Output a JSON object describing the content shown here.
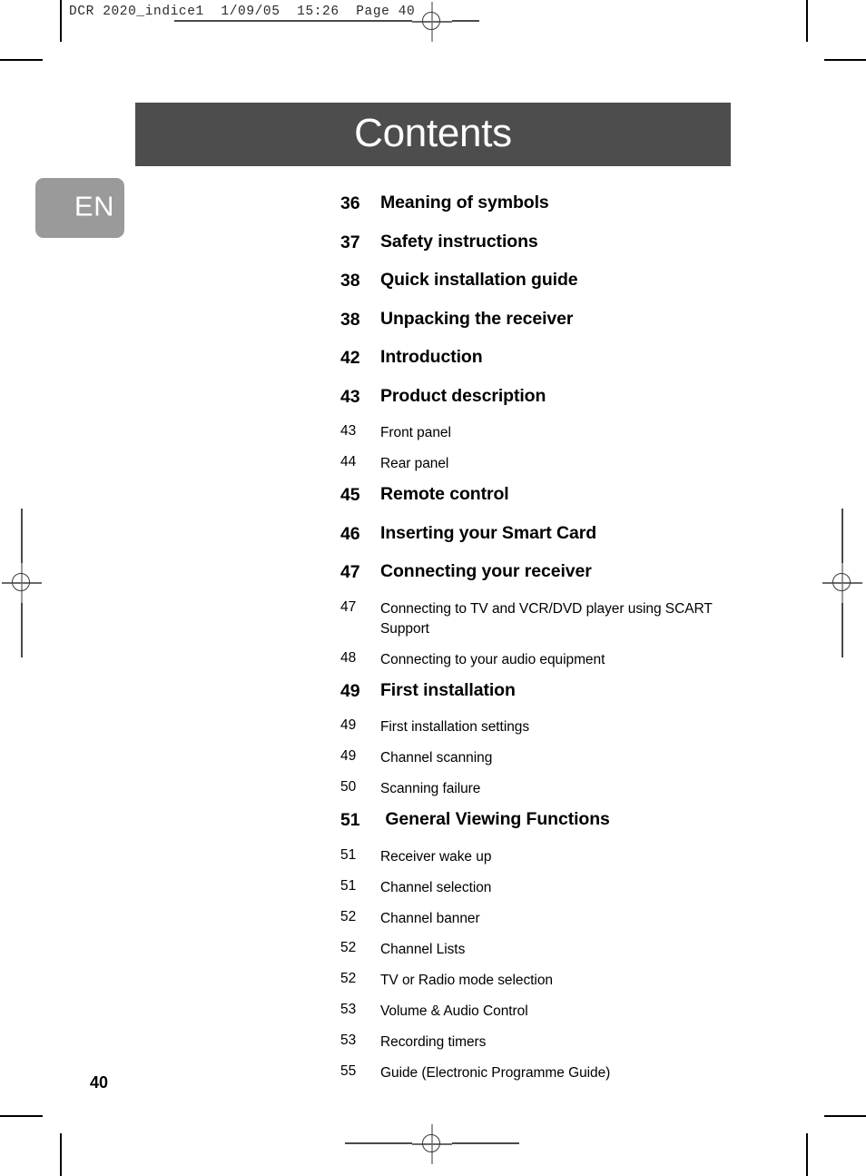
{
  "printer_header": "DCR 2020_indice1  1/09/05  15:26  Page 40",
  "title_bar": {
    "title": "Contents",
    "background_color": "#4d4d4d",
    "text_color": "#ffffff"
  },
  "language_tab": {
    "label": "EN",
    "background_color": "#9a9a9a",
    "text_color": "#ffffff"
  },
  "toc": {
    "entries": [
      {
        "page": "36",
        "label": "Meaning of symbols",
        "level": "major"
      },
      {
        "page": "37",
        "label": "Safety instructions",
        "level": "major"
      },
      {
        "page": "38",
        "label": "Quick installation guide",
        "level": "major"
      },
      {
        "page": "38",
        "label": "Unpacking the receiver",
        "level": "major"
      },
      {
        "page": "42",
        "label": "Introduction",
        "level": "major"
      },
      {
        "page": "43",
        "label": "Product description",
        "level": "major"
      },
      {
        "page": "43",
        "label": "Front panel",
        "level": "minor"
      },
      {
        "page": "44",
        "label": "Rear panel",
        "level": "minor"
      },
      {
        "page": "45",
        "label": "Remote control",
        "level": "major"
      },
      {
        "page": "46",
        "label": "Inserting your Smart Card",
        "level": "major"
      },
      {
        "page": "47",
        "label": "Connecting your receiver",
        "level": "major"
      },
      {
        "page": "47",
        "label": "Connecting to TV and VCR/DVD player using SCART Support",
        "level": "minor"
      },
      {
        "page": "48",
        "label": "Connecting to your audio equipment",
        "level": "minor"
      },
      {
        "page": "49",
        "label": "First installation",
        "level": "major"
      },
      {
        "page": "49",
        "label": "First installation settings",
        "level": "minor"
      },
      {
        "page": "49",
        "label": "Channel scanning",
        "level": "minor"
      },
      {
        "page": "50",
        "label": "Scanning failure",
        "level": "minor"
      },
      {
        "page": "51",
        "label": " General Viewing Functions",
        "level": "major"
      },
      {
        "page": "51",
        "label": "Receiver wake up",
        "level": "minor"
      },
      {
        "page": "51",
        "label": "Channel selection",
        "level": "minor"
      },
      {
        "page": "52",
        "label": "Channel banner",
        "level": "minor"
      },
      {
        "page": "52",
        "label": "Channel Lists",
        "level": "minor"
      },
      {
        "page": "52",
        "label": "TV or Radio mode selection",
        "level": "minor"
      },
      {
        "page": "53",
        "label": "Volume & Audio Control",
        "level": "minor"
      },
      {
        "page": "53",
        "label": "Recording timers",
        "level": "minor"
      },
      {
        "page": "55",
        "label": "Guide (Electronic Programme Guide)",
        "level": "minor"
      }
    ]
  },
  "page_number": "40"
}
